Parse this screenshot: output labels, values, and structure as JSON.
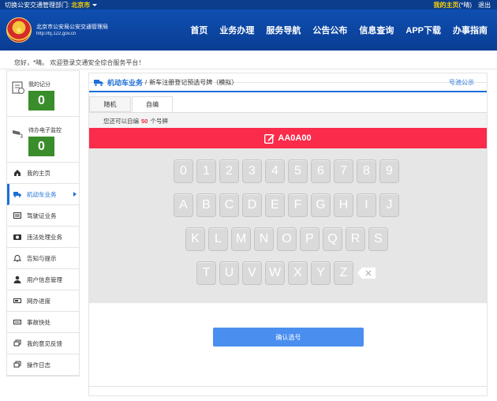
{
  "topbar": {
    "dept_label": "切换公安交通管理部门:",
    "city": "北京市",
    "my_home": "我的主页",
    "user_name": "(*晴)",
    "logout": "退出"
  },
  "header": {
    "bureau": "北京市公安局公安交通管理局",
    "title": "交通安全综合服务管理平台",
    "url": "http://bj.122.gov.cn",
    "nav": [
      "首页",
      "业务办理",
      "服务导航",
      "公告公布",
      "信息查询",
      "APP下载",
      "办事指南"
    ]
  },
  "welcome": "您好，*晴。 欢迎登录交通安全综合服务平台！",
  "sidebar": {
    "record_label": "我的记分",
    "record_value": "0",
    "monitor_label": "待办电子监控",
    "monitor_value": "0",
    "items": [
      {
        "label": "我的主页",
        "icon": "home-icon"
      },
      {
        "label": "机动车业务",
        "icon": "truck-icon"
      },
      {
        "label": "驾驶证业务",
        "icon": "license-icon"
      },
      {
        "label": "违法处理业务",
        "icon": "camera-icon"
      },
      {
        "label": "告知与提示",
        "icon": "bell-icon"
      },
      {
        "label": "用户信息管理",
        "icon": "user-icon"
      },
      {
        "label": "网办进度",
        "icon": "progress-icon"
      },
      {
        "label": "事故快处",
        "icon": "accident-icon"
      },
      {
        "label": "我的意见反馈",
        "icon": "feedback-icon"
      },
      {
        "label": "操作日志",
        "icon": "log-icon"
      }
    ]
  },
  "main": {
    "breadcrumb_biz": "机动车业务",
    "breadcrumb_sep": "/",
    "breadcrumb_page": "新车注册登记预选号牌（模拟）",
    "pool_link": "号池公示",
    "tabs": [
      "随机",
      "自编"
    ],
    "hint_prefix": "您还可以自编",
    "hint_count": "50",
    "hint_suffix": "个号牌",
    "plate": "AA0A00",
    "keys_row1": [
      "0",
      "1",
      "2",
      "3",
      "4",
      "5",
      "6",
      "7",
      "8",
      "9"
    ],
    "keys_row2": [
      "A",
      "B",
      "C",
      "D",
      "E",
      "F",
      "G",
      "H",
      "I",
      "J"
    ],
    "keys_row3": [
      "K",
      "L",
      "M",
      "N",
      "O",
      "P",
      "Q",
      "R",
      "S"
    ],
    "keys_row4": [
      "T",
      "U",
      "V",
      "W",
      "X",
      "Y",
      "Z"
    ],
    "confirm": "确认选号"
  },
  "colors": {
    "brand_blue": "#0e4fb1",
    "accent_blue": "#1d6fd8",
    "plate_red": "#fa2b4b",
    "score_green": "#3a8d2b",
    "confirm_blue": "#4a8ff0"
  }
}
